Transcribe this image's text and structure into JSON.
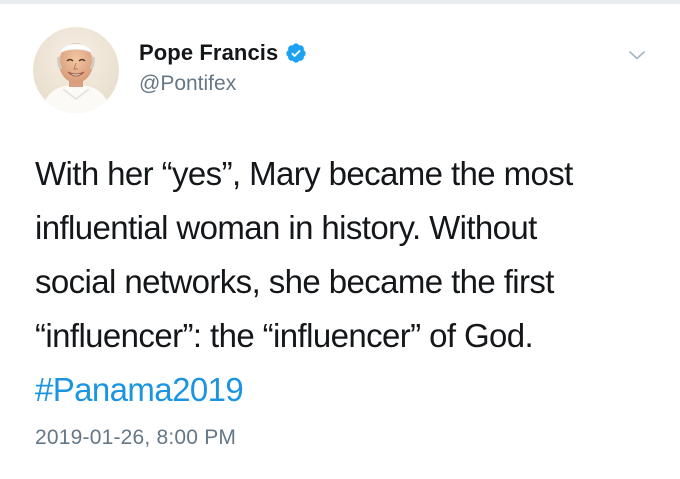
{
  "tweet": {
    "author": {
      "display_name": "Pope Francis",
      "handle": "@Pontifex",
      "verified": true
    },
    "text_lines": [
      "With her “yes”, Mary became the most",
      "influential woman in history. Without",
      "social networks, she became the first",
      "“influencer”: the “influencer” of God."
    ],
    "hashtag": "#Panama2019",
    "timestamp": "2019-01-26, 8:00 PM"
  },
  "icons": {
    "verified": "verified-badge-icon",
    "menu": "chevron-down-icon"
  },
  "colors": {
    "text": "#14171a",
    "secondary": "#657786",
    "link": "#1b95e0",
    "verified_badge": "#1da1f2"
  }
}
